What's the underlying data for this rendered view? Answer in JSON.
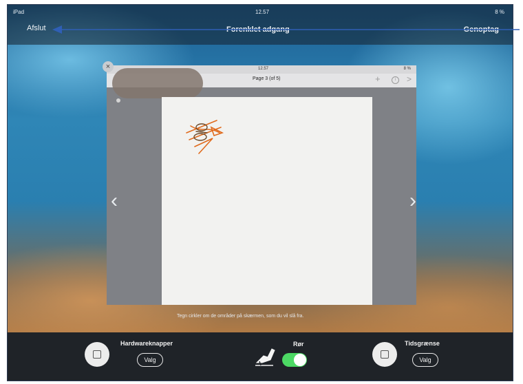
{
  "device": {
    "label": "iPad",
    "time": "12.57",
    "battery": "8 %"
  },
  "topbar": {
    "quit_label": "Afslut",
    "title": "Forenklet adgang",
    "resume_label": "Genoptag"
  },
  "preview": {
    "time": "12.57",
    "battery": "8 %",
    "page_label": "Page 3 (of 5)",
    "plus_icon": "plus-icon",
    "info_icon": "info-icon",
    "next_icon": "chevron-right-icon"
  },
  "hint": "Tegn cirkler om de områder på skærmen, som du vil slå fra.",
  "bottom": {
    "hardware": {
      "label": "Hardwareknapper",
      "options_label": "Valg"
    },
    "touch": {
      "label": "Rør",
      "enabled": true
    },
    "time_limit": {
      "label": "Tidsgrænse",
      "options_label": "Valg"
    }
  },
  "colors": {
    "toggle_on": "#4cd964",
    "annotation_arrow": "#2f5fb5",
    "scribble": "#e06a1c"
  }
}
